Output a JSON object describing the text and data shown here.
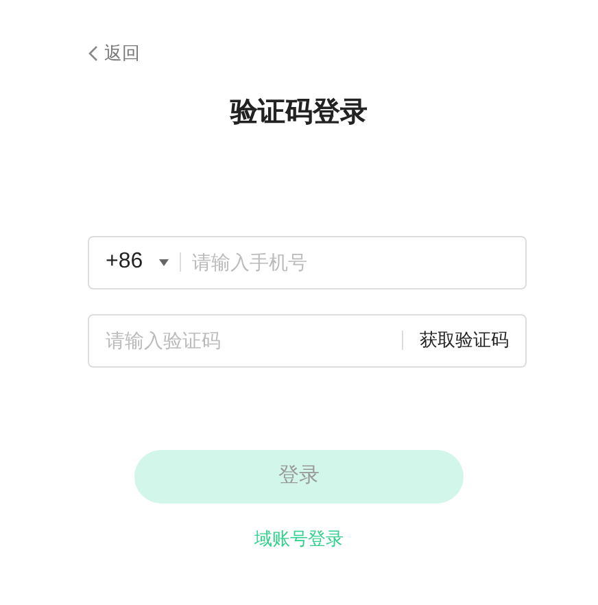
{
  "back": {
    "label": "返回"
  },
  "title": "验证码登录",
  "phone": {
    "country_code": "+86",
    "placeholder": "请输入手机号"
  },
  "code": {
    "placeholder": "请输入验证码",
    "get_code": "获取验证码"
  },
  "login_button": {
    "label": "登录",
    "disabled": true
  },
  "alt_login": "域账号登录"
}
